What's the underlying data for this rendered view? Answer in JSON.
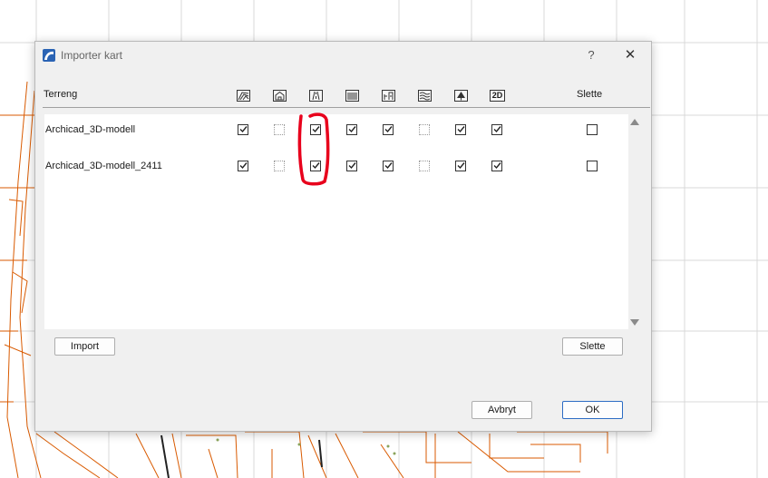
{
  "dialog": {
    "title": "Importer kart",
    "help_label": "?",
    "close_label": "✕",
    "app_icon": "archicad-icon"
  },
  "table": {
    "name_header": "Terreng",
    "delete_header": "Slette",
    "layer_icons": [
      "terrain-layers-icon",
      "building-icon",
      "road-icon",
      "rail-icon",
      "vegetation-icon",
      "water-icon",
      "tree-icon",
      "2d-icon"
    ],
    "layer_2d_label": "2D",
    "rows": [
      {
        "name": "Archicad_3D-modell",
        "layers": [
          true,
          null,
          true,
          true,
          true,
          null,
          true,
          true
        ],
        "delete": false
      },
      {
        "name": "Archicad_3D-modell_2411",
        "layers": [
          true,
          null,
          true,
          true,
          true,
          null,
          true,
          true
        ],
        "delete": false
      }
    ]
  },
  "buttons": {
    "import": "Import",
    "delete": "Slette",
    "cancel": "Avbryt",
    "ok": "OK"
  },
  "colors": {
    "annotation": "#e8001c",
    "map_lines": "#d95a00",
    "default_button_border": "#2c6cc4"
  }
}
